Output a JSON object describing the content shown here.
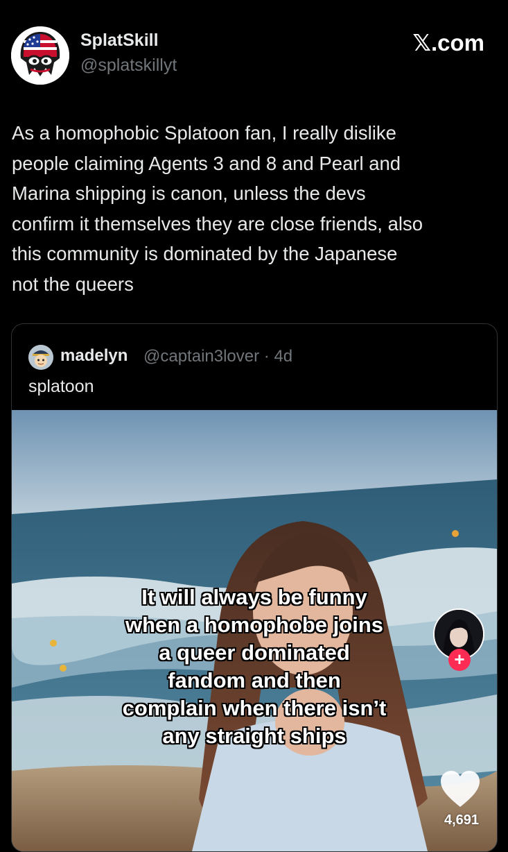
{
  "author": {
    "display_name": "SplatSkill",
    "handle": "@splatskillyt",
    "avatar_icon": "squid-flag-avatar"
  },
  "site_label": "𝕏.com",
  "tweet": {
    "text": "As a homophobic Splatoon fan, I really dislike\npeople claiming Agents 3 and 8 and Pearl and\nMarina shipping is canon, unless the devs\nconfirm it themselves they are close friends, also\nthis community is dominated by the Japanese\nnot the queers"
  },
  "quote": {
    "display_name": "madelyn",
    "meta": "@captain3lover · 4d",
    "text": "splatoon",
    "media": {
      "caption_lines": [
        "It will always be funny",
        "when a homophobe joins",
        "a queer dominated",
        "fandom and then",
        "complain when there isn’t",
        "any straight ships"
      ],
      "follow_icon": "plus-icon",
      "follow_symbol": "+",
      "like_icon": "heart-icon",
      "like_count": "4,691"
    }
  },
  "colors": {
    "background": "#000000",
    "primary_text": "#e7e9ea",
    "secondary_text": "#71767b",
    "border": "#2f3336",
    "follow_accent": "#fe2c55"
  }
}
